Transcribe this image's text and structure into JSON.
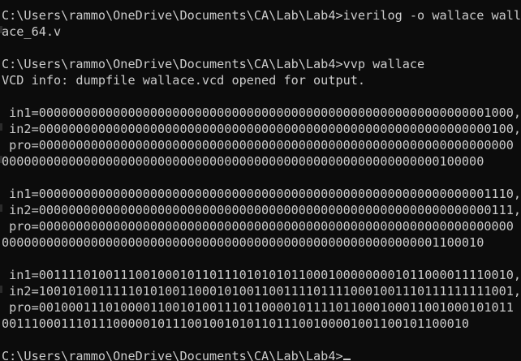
{
  "terminal": {
    "background": "#0c0c0c",
    "foreground": "#cccccc",
    "lines": [
      "C:\\Users\\rammo\\OneDrive\\Documents\\CA\\Lab\\Lab4>iverilog -o wallace wall",
      "ace_64.v",
      "",
      "C:\\Users\\rammo\\OneDrive\\Documents\\CA\\Lab\\Lab4>vvp wallace",
      "VCD info: dumpfile wallace.vcd opened for output.",
      "",
      " in1=0000000000000000000000000000000000000000000000000000000000001000,",
      " in2=0000000000000000000000000000000000000000000000000000000000000100,",
      " pro=0000000000000000000000000000000000000000000000000000000000000000",
      "00000000000000000000000000000000000000000000000000000000000100000",
      "",
      " in1=0000000000000000000000000000000000000000000000000000000000001110,",
      " in2=0000000000000000000000000000000000000000000000000000000000000111,",
      " pro=0000000000000000000000000000000000000000000000000000000000000000",
      "00000000000000000000000000000000000000000000000000000000001100010",
      "",
      " in1=0011110100111001000101101110101010110001000000001011000011110010,",
      " in2=1001010011111010100110001010011001111011110001001110111111111001,",
      " pro=0010001110100001100101001110110000101111011000100011001000101011",
      "001110001110111000001011100100101011011100100001001100101100010",
      "",
      "C:\\Users\\rammo\\OneDrive\\Documents\\CA\\Lab\\Lab4>"
    ]
  }
}
